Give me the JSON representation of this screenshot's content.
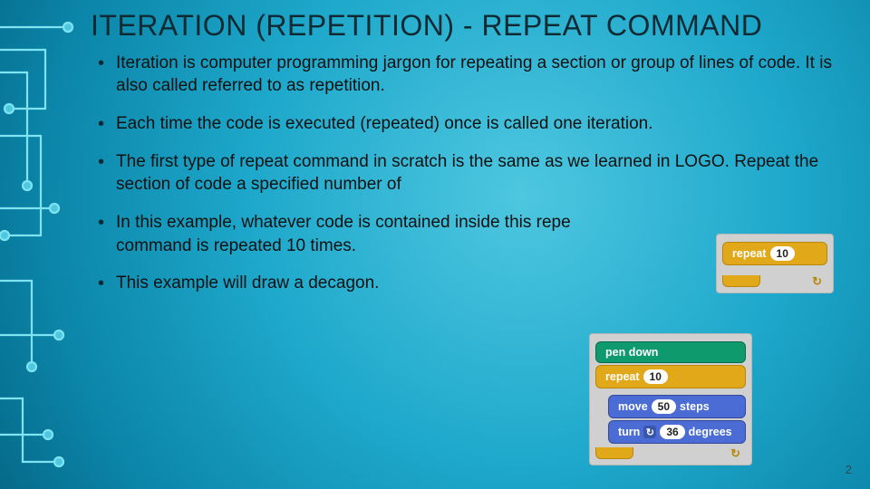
{
  "title": "ITERATION (REPETITION) - REPEAT COMMAND",
  "bullets": [
    "Iteration is computer programming jargon for repeating a section or group of lines of code.  It is also called referred to as repetition.",
    "Each time the code is executed (repeated) once is called one iteration.",
    "The first type of repeat command in scratch is the same as we learned in LOGO.  Repeat the section of code a specified number of",
    "In this example, whatever code is contained inside this repe command is repeated 10 times.",
    "This example will draw a decagon."
  ],
  "page_number": "2",
  "scratch_small": {
    "repeat_label": "repeat",
    "repeat_value": "10"
  },
  "scratch_big": {
    "pen_label": "pen down",
    "repeat_label": "repeat",
    "repeat_value": "10",
    "move_label": "move",
    "move_value": "50",
    "move_suffix": "steps",
    "turn_label": "turn",
    "turn_value": "36",
    "turn_suffix": "degrees"
  }
}
